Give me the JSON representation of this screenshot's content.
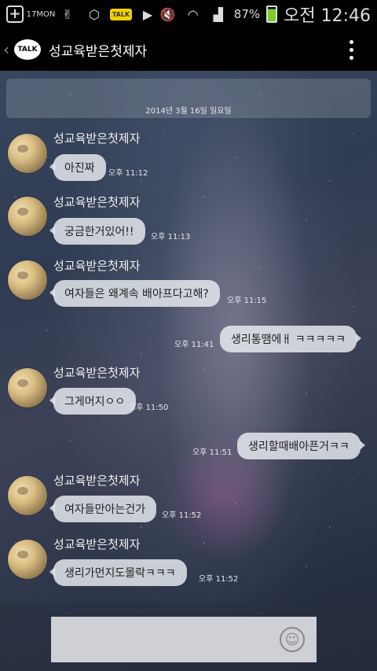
{
  "status_bar": {
    "calendar_date": "17",
    "calendar_day": "MON",
    "talk_badge": "TALK",
    "battery_pct": "87%",
    "time": "오전 12:46",
    "icons": [
      "plus-box-icon",
      "calendar-icon",
      "peace-hand-icon",
      "exo-logo-icon",
      "kakaotalk-icon",
      "play-icon",
      "mute-icon",
      "wifi-icon",
      "signal-icon",
      "battery-charging-icon"
    ]
  },
  "header": {
    "back": "‹",
    "logo_text": "TALK",
    "title": "성교육받은첫제자"
  },
  "date_divider": "2014년 3월 16일 일요일",
  "messages": [
    {
      "dir": "in",
      "sender": "성교육받은첫제자",
      "text": "아진짜",
      "time": "오후 11:12"
    },
    {
      "dir": "in",
      "sender": "성교육받은첫제자",
      "text": "궁금한거있어!!",
      "time": "오후 11:13"
    },
    {
      "dir": "in",
      "sender": "성교육받은첫제자",
      "text": "여자들은 왜계속 배아프다고해?",
      "time": "오후 11:15"
    },
    {
      "dir": "out",
      "text": "생리통땜에ㅐ ㅋㅋㅋㅋㅋ",
      "time": "오후 11:41"
    },
    {
      "dir": "in",
      "sender": "성교육받은첫제자",
      "text": "그게머지ㅇㅇ",
      "time": "오후 11:50"
    },
    {
      "dir": "out",
      "text": "생리할때배아픈거ㅋㅋ",
      "time": "오후 11:51"
    },
    {
      "dir": "in",
      "sender": "성교육받은첫제자",
      "text": "여자들만아는건가",
      "time": "오후 11:52"
    },
    {
      "dir": "in",
      "sender": "성교육받은첫제자",
      "text": "생리가먼지도몰락ㅋㅋㅋ",
      "time": "오후 11:52"
    }
  ],
  "input": {
    "value": "",
    "emoji": "☺"
  }
}
